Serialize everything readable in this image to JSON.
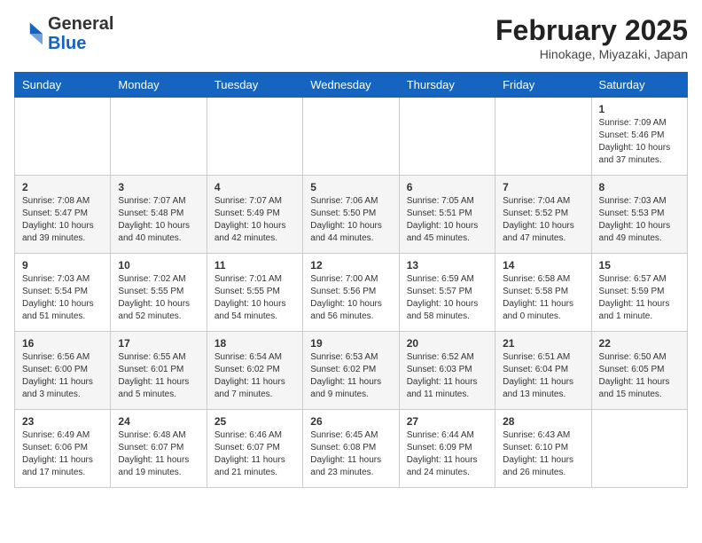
{
  "header": {
    "logo_general": "General",
    "logo_blue": "Blue",
    "month_title": "February 2025",
    "subtitle": "Hinokage, Miyazaki, Japan"
  },
  "days_of_week": [
    "Sunday",
    "Monday",
    "Tuesday",
    "Wednesday",
    "Thursday",
    "Friday",
    "Saturday"
  ],
  "weeks": [
    [
      {
        "day": "",
        "info": ""
      },
      {
        "day": "",
        "info": ""
      },
      {
        "day": "",
        "info": ""
      },
      {
        "day": "",
        "info": ""
      },
      {
        "day": "",
        "info": ""
      },
      {
        "day": "",
        "info": ""
      },
      {
        "day": "1",
        "info": "Sunrise: 7:09 AM\nSunset: 5:46 PM\nDaylight: 10 hours and 37 minutes."
      }
    ],
    [
      {
        "day": "2",
        "info": "Sunrise: 7:08 AM\nSunset: 5:47 PM\nDaylight: 10 hours and 39 minutes."
      },
      {
        "day": "3",
        "info": "Sunrise: 7:07 AM\nSunset: 5:48 PM\nDaylight: 10 hours and 40 minutes."
      },
      {
        "day": "4",
        "info": "Sunrise: 7:07 AM\nSunset: 5:49 PM\nDaylight: 10 hours and 42 minutes."
      },
      {
        "day": "5",
        "info": "Sunrise: 7:06 AM\nSunset: 5:50 PM\nDaylight: 10 hours and 44 minutes."
      },
      {
        "day": "6",
        "info": "Sunrise: 7:05 AM\nSunset: 5:51 PM\nDaylight: 10 hours and 45 minutes."
      },
      {
        "day": "7",
        "info": "Sunrise: 7:04 AM\nSunset: 5:52 PM\nDaylight: 10 hours and 47 minutes."
      },
      {
        "day": "8",
        "info": "Sunrise: 7:03 AM\nSunset: 5:53 PM\nDaylight: 10 hours and 49 minutes."
      }
    ],
    [
      {
        "day": "9",
        "info": "Sunrise: 7:03 AM\nSunset: 5:54 PM\nDaylight: 10 hours and 51 minutes."
      },
      {
        "day": "10",
        "info": "Sunrise: 7:02 AM\nSunset: 5:55 PM\nDaylight: 10 hours and 52 minutes."
      },
      {
        "day": "11",
        "info": "Sunrise: 7:01 AM\nSunset: 5:55 PM\nDaylight: 10 hours and 54 minutes."
      },
      {
        "day": "12",
        "info": "Sunrise: 7:00 AM\nSunset: 5:56 PM\nDaylight: 10 hours and 56 minutes."
      },
      {
        "day": "13",
        "info": "Sunrise: 6:59 AM\nSunset: 5:57 PM\nDaylight: 10 hours and 58 minutes."
      },
      {
        "day": "14",
        "info": "Sunrise: 6:58 AM\nSunset: 5:58 PM\nDaylight: 11 hours and 0 minutes."
      },
      {
        "day": "15",
        "info": "Sunrise: 6:57 AM\nSunset: 5:59 PM\nDaylight: 11 hours and 1 minute."
      }
    ],
    [
      {
        "day": "16",
        "info": "Sunrise: 6:56 AM\nSunset: 6:00 PM\nDaylight: 11 hours and 3 minutes."
      },
      {
        "day": "17",
        "info": "Sunrise: 6:55 AM\nSunset: 6:01 PM\nDaylight: 11 hours and 5 minutes."
      },
      {
        "day": "18",
        "info": "Sunrise: 6:54 AM\nSunset: 6:02 PM\nDaylight: 11 hours and 7 minutes."
      },
      {
        "day": "19",
        "info": "Sunrise: 6:53 AM\nSunset: 6:02 PM\nDaylight: 11 hours and 9 minutes."
      },
      {
        "day": "20",
        "info": "Sunrise: 6:52 AM\nSunset: 6:03 PM\nDaylight: 11 hours and 11 minutes."
      },
      {
        "day": "21",
        "info": "Sunrise: 6:51 AM\nSunset: 6:04 PM\nDaylight: 11 hours and 13 minutes."
      },
      {
        "day": "22",
        "info": "Sunrise: 6:50 AM\nSunset: 6:05 PM\nDaylight: 11 hours and 15 minutes."
      }
    ],
    [
      {
        "day": "23",
        "info": "Sunrise: 6:49 AM\nSunset: 6:06 PM\nDaylight: 11 hours and 17 minutes."
      },
      {
        "day": "24",
        "info": "Sunrise: 6:48 AM\nSunset: 6:07 PM\nDaylight: 11 hours and 19 minutes."
      },
      {
        "day": "25",
        "info": "Sunrise: 6:46 AM\nSunset: 6:07 PM\nDaylight: 11 hours and 21 minutes."
      },
      {
        "day": "26",
        "info": "Sunrise: 6:45 AM\nSunset: 6:08 PM\nDaylight: 11 hours and 23 minutes."
      },
      {
        "day": "27",
        "info": "Sunrise: 6:44 AM\nSunset: 6:09 PM\nDaylight: 11 hours and 24 minutes."
      },
      {
        "day": "28",
        "info": "Sunrise: 6:43 AM\nSunset: 6:10 PM\nDaylight: 11 hours and 26 minutes."
      },
      {
        "day": "",
        "info": ""
      }
    ]
  ]
}
